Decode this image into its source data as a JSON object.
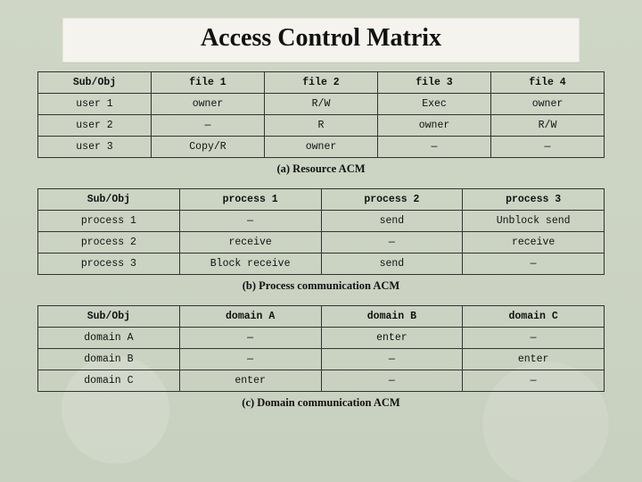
{
  "title": "Access Control Matrix",
  "tables": [
    {
      "headers": [
        "Sub/Obj",
        "file 1",
        "file 2",
        "file 3",
        "file 4"
      ],
      "rows": [
        [
          "user 1",
          "owner",
          "R/W",
          "Exec",
          "owner"
        ],
        [
          "user 2",
          "—",
          "R",
          "owner",
          "R/W"
        ],
        [
          "user 3",
          "Copy/R",
          "owner",
          "—",
          "—"
        ]
      ],
      "caption": "(a) Resource ACM"
    },
    {
      "headers": [
        "Sub/Obj",
        "process 1",
        "process 2",
        "process 3"
      ],
      "rows": [
        [
          "process 1",
          "—",
          "send",
          "Unblock send"
        ],
        [
          "process 2",
          "receive",
          "—",
          "receive"
        ],
        [
          "process 3",
          "Block receive",
          "send",
          "—"
        ]
      ],
      "caption": "(b) Process communication ACM"
    },
    {
      "headers": [
        "Sub/Obj",
        "domain A",
        "domain B",
        "domain C"
      ],
      "rows": [
        [
          "domain A",
          "—",
          "enter",
          "—"
        ],
        [
          "domain B",
          "—",
          "—",
          "enter"
        ],
        [
          "domain C",
          "enter",
          "—",
          "—"
        ]
      ],
      "caption": "(c) Domain communication ACM"
    }
  ]
}
